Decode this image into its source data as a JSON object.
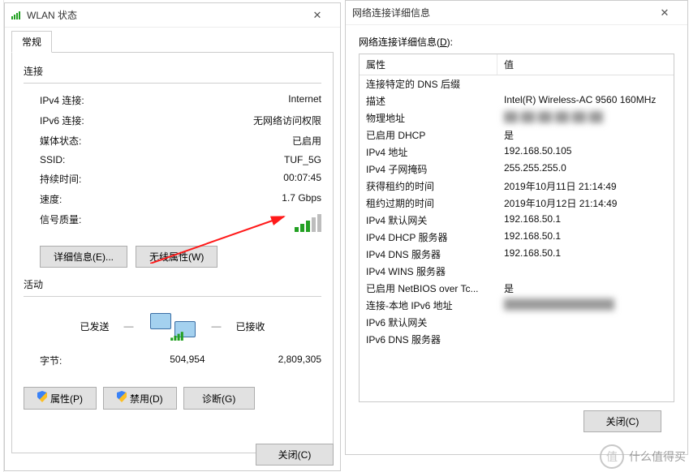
{
  "status_window": {
    "title": "WLAN 状态",
    "tab": "常规",
    "connection": {
      "section": "连接",
      "rows": [
        {
          "k": "IPv4 连接:",
          "v": "Internet"
        },
        {
          "k": "IPv6 连接:",
          "v": "无网络访问权限"
        },
        {
          "k": "媒体状态:",
          "v": "已启用"
        },
        {
          "k": "SSID:",
          "v": "TUF_5G"
        },
        {
          "k": "持续时间:",
          "v": "00:07:45"
        },
        {
          "k": "速度:",
          "v": "1.7 Gbps"
        }
      ],
      "signal_label": "信号质量:",
      "btn_details": "详细信息(E)...",
      "btn_wireless": "无线属性(W)"
    },
    "activity": {
      "section": "活动",
      "sent": "已发送",
      "recv": "已接收",
      "bytes_label": "字节:",
      "bytes_sent": "504,954",
      "bytes_recv": "2,809,305",
      "btn_props": "属性(P)",
      "btn_disable": "禁用(D)",
      "btn_diag": "诊断(G)"
    },
    "btn_close": "关闭(C)"
  },
  "detail_window": {
    "title": "网络连接详细信息",
    "subtitle_prefix": "网络连接详细信息(",
    "subtitle_u": "D",
    "subtitle_suffix": "):",
    "header_prop": "属性",
    "header_val": "值",
    "rows": [
      {
        "p": "连接特定的 DNS 后缀",
        "v": ""
      },
      {
        "p": "描述",
        "v": "Intel(R) Wireless-AC 9560 160MHz"
      },
      {
        "p": "物理地址",
        "v": "██-██-██-██-██-██",
        "blur": true
      },
      {
        "p": "已启用 DHCP",
        "v": "是"
      },
      {
        "p": "IPv4 地址",
        "v": "192.168.50.105"
      },
      {
        "p": "IPv4 子网掩码",
        "v": "255.255.255.0"
      },
      {
        "p": "获得租约的时间",
        "v": "2019年10月11日 21:14:49"
      },
      {
        "p": "租约过期的时间",
        "v": "2019年10月12日 21:14:49"
      },
      {
        "p": "IPv4 默认网关",
        "v": "192.168.50.1"
      },
      {
        "p": "IPv4 DHCP 服务器",
        "v": "192.168.50.1"
      },
      {
        "p": "IPv4 DNS 服务器",
        "v": "192.168.50.1"
      },
      {
        "p": "IPv4 WINS 服务器",
        "v": ""
      },
      {
        "p": "已启用 NetBIOS over Tc...",
        "v": "是"
      },
      {
        "p": "连接-本地 IPv6 地址",
        "v": "████████████████",
        "blur": true
      },
      {
        "p": "IPv6 默认网关",
        "v": ""
      },
      {
        "p": "IPv6 DNS 服务器",
        "v": ""
      }
    ],
    "btn_close": "关闭(C)"
  },
  "watermark": {
    "icon": "值",
    "text": "什么值得买"
  }
}
